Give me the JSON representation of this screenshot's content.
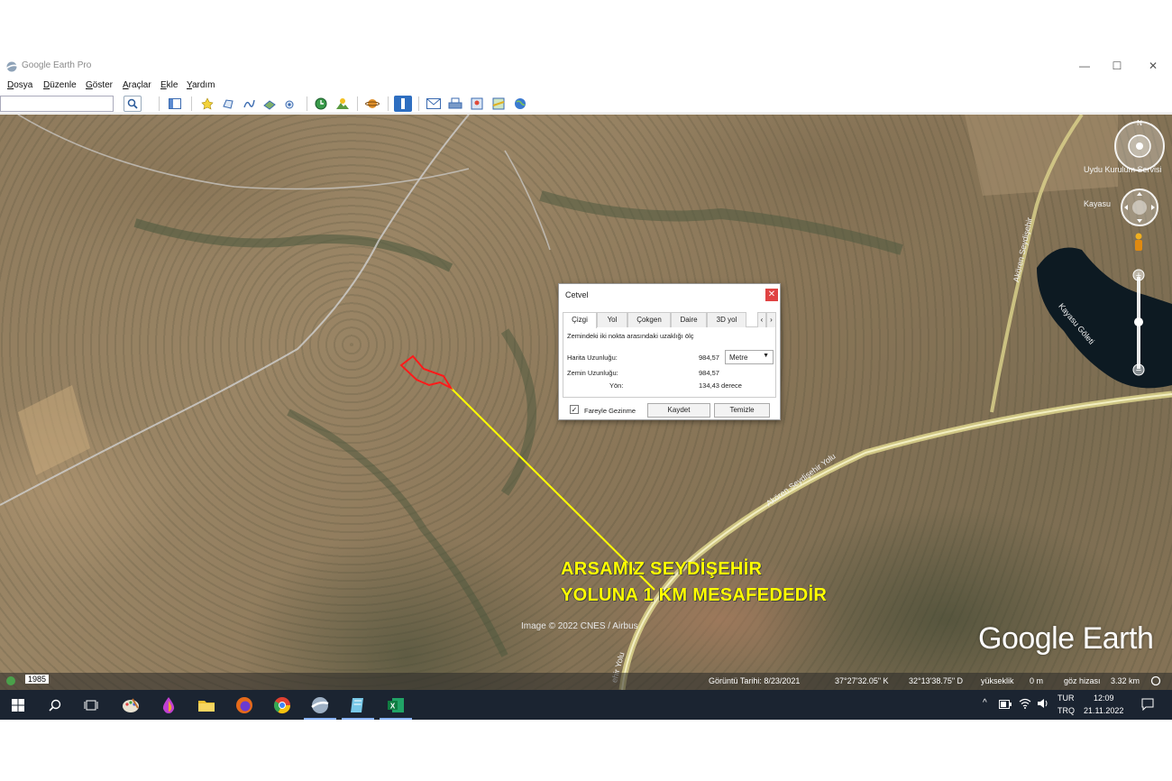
{
  "window": {
    "title": "Google Earth Pro"
  },
  "menu": [
    "Dosya",
    "Düzenle",
    "Göster",
    "Araçlar",
    "Ekle",
    "Yardım"
  ],
  "search": {
    "value": ""
  },
  "map": {
    "annotation_line1": "ARSAMIZ SEYDİŞEHİR",
    "annotation_line2": "YOLUNA 1 KM MESAFEDEDİR",
    "image_credit": "Image © 2022 CNES / Airbus",
    "brand": "Google Earth",
    "road_label_main": "Akören Seydişehir Yolu",
    "road_label_lower": "ehir Yolu",
    "road_label_north": "Akören Seydişehir",
    "place_lake": "Kayasu Göleti",
    "place_service": "Uydu Kurulum Servisi",
    "place_kayasu": "Kayasu",
    "colors": {
      "measure_line": "#ffff00",
      "parcel_outline": "#ff1a1a",
      "annotation": "#ffff00"
    }
  },
  "dialog": {
    "title": "Cetvel",
    "tabs": [
      "Çizgi",
      "Yol",
      "Çokgen",
      "Daire",
      "3D yol"
    ],
    "active_tab": "Çizgi",
    "description": "Zemindeki iki nokta arasındaki uzaklığı ölç",
    "map_length_label": "Harita Uzunluğu:",
    "map_length_value": "984,57",
    "unit": "Metre",
    "ground_length_label": "Zemin Uzunluğu:",
    "ground_length_value": "984,57",
    "heading_label": "Yön:",
    "heading_value": "134,43 derece",
    "mouse_nav_label": "Fareyle Gezinme",
    "mouse_nav_checked": true,
    "save_label": "Kaydet",
    "clear_label": "Temizle"
  },
  "status": {
    "year": "1985",
    "image_date": "Görüntü Tarihi: 8/23/2021",
    "lat": "37°27'32.05\" K",
    "lon": "32°13'38.75\" D",
    "elevation": "yükseklik",
    "elev_value": "0 m",
    "eye_alt_label": "göz hizası",
    "eye_alt": "3.32 km"
  },
  "taskbar": {
    "lang_top": "TUR",
    "lang_bottom": "TRQ",
    "time": "12:09",
    "date": "21.11.2022"
  }
}
